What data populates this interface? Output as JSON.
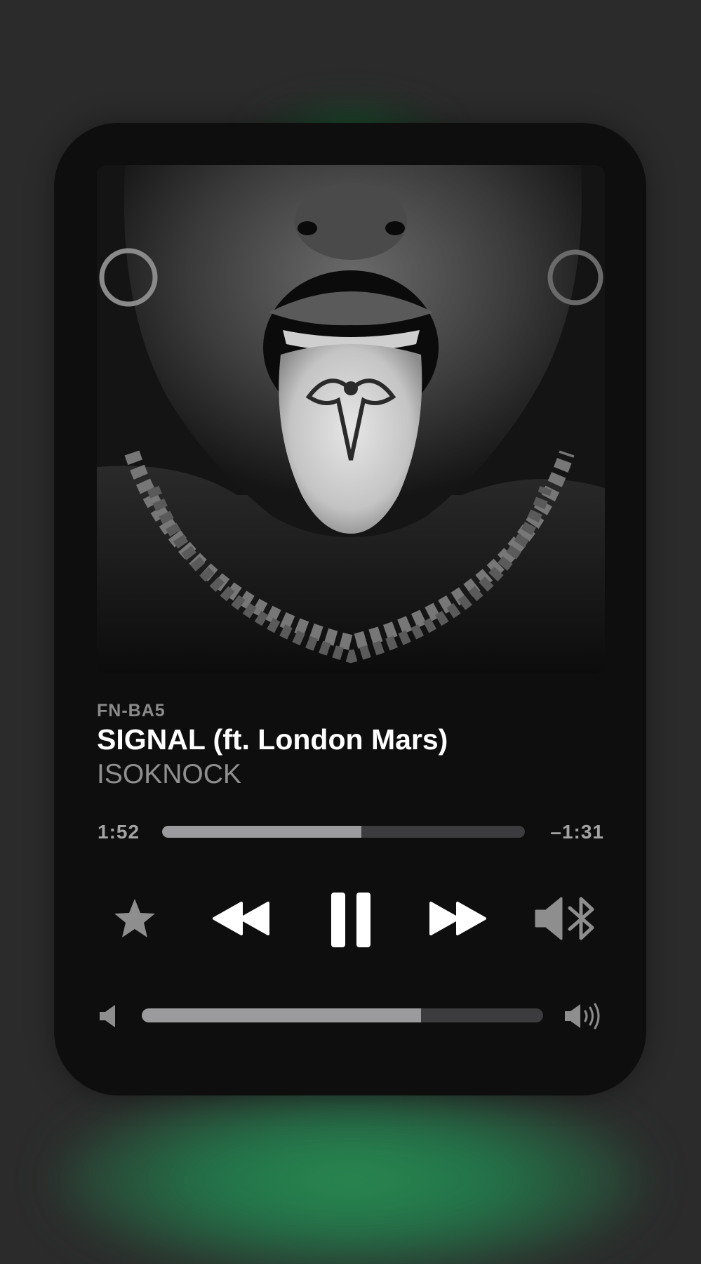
{
  "track": {
    "album": "FN-BA5",
    "title": "SIGNAL (ft. London Mars)",
    "artist": "ISOKNOCK"
  },
  "playback": {
    "elapsed": "1:52",
    "remaining": "–1:31",
    "progress_fraction": 0.55,
    "state": "playing"
  },
  "volume": {
    "level_fraction": 0.695
  },
  "controls": [
    {
      "name": "favorite",
      "icon": "star-icon"
    },
    {
      "name": "rewind",
      "icon": "rewind-icon"
    },
    {
      "name": "pause",
      "icon": "pause-icon"
    },
    {
      "name": "fast-forward",
      "icon": "fast-forward-icon"
    },
    {
      "name": "audio-output",
      "icon": "speaker-bluetooth-icon"
    }
  ],
  "colors": {
    "background": "#2b2b2b",
    "card": "#0e0e0e",
    "accent_glow": "#2a8a50",
    "track_fill": "#9b9b9d",
    "track_bg": "#3c3c3e",
    "secondary_text": "#8f8f8f"
  }
}
